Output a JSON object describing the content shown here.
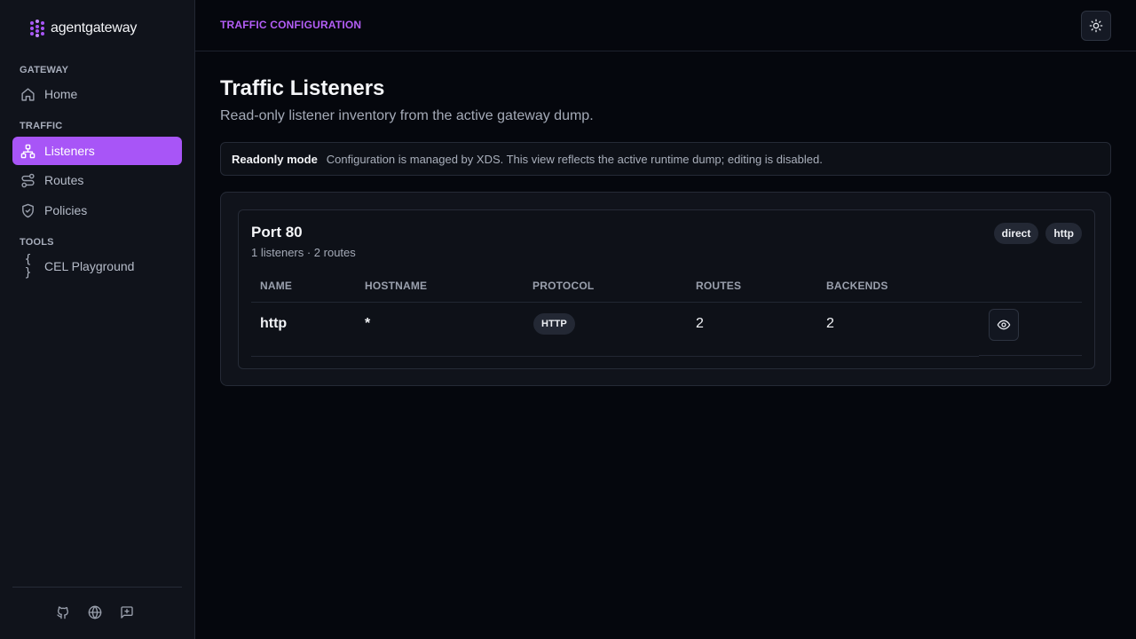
{
  "app": {
    "name": "agentgateway",
    "accent_color": "#a855f7"
  },
  "sidebar": {
    "sections": [
      {
        "title": "GATEWAY",
        "items": [
          {
            "label": "Home",
            "icon": "home-icon",
            "active": false
          }
        ]
      },
      {
        "title": "TRAFFIC",
        "items": [
          {
            "label": "Listeners",
            "icon": "network-icon",
            "active": true
          },
          {
            "label": "Routes",
            "icon": "route-icon",
            "active": false
          },
          {
            "label": "Policies",
            "icon": "shield-icon",
            "active": false
          }
        ]
      },
      {
        "title": "TOOLS",
        "items": [
          {
            "label": "CEL Playground",
            "icon": "braces-icon",
            "active": false
          }
        ]
      }
    ],
    "footer_icons": [
      "github-icon",
      "globe-icon",
      "feedback-icon"
    ]
  },
  "header": {
    "breadcrumb": "TRAFFIC CONFIGURATION",
    "theme_toggle_icon": "sun-icon"
  },
  "main": {
    "title": "Traffic Listeners",
    "subtitle": "Read-only listener inventory from the active gateway dump.",
    "notice": {
      "title": "Readonly mode",
      "text": "Configuration is managed by XDS. This view reflects the active runtime dump; editing is disabled."
    },
    "port": {
      "title": "Port 80",
      "meta": "1 listeners · 2 routes",
      "tags": [
        "direct",
        "http"
      ],
      "columns": [
        "NAME",
        "HOSTNAME",
        "PROTOCOL",
        "ROUTES",
        "BACKENDS"
      ],
      "rows": [
        {
          "name": "http",
          "hostname": "*",
          "protocol": "HTTP",
          "routes": "2",
          "backends": "2",
          "action_icon": "eye-icon"
        }
      ]
    }
  }
}
